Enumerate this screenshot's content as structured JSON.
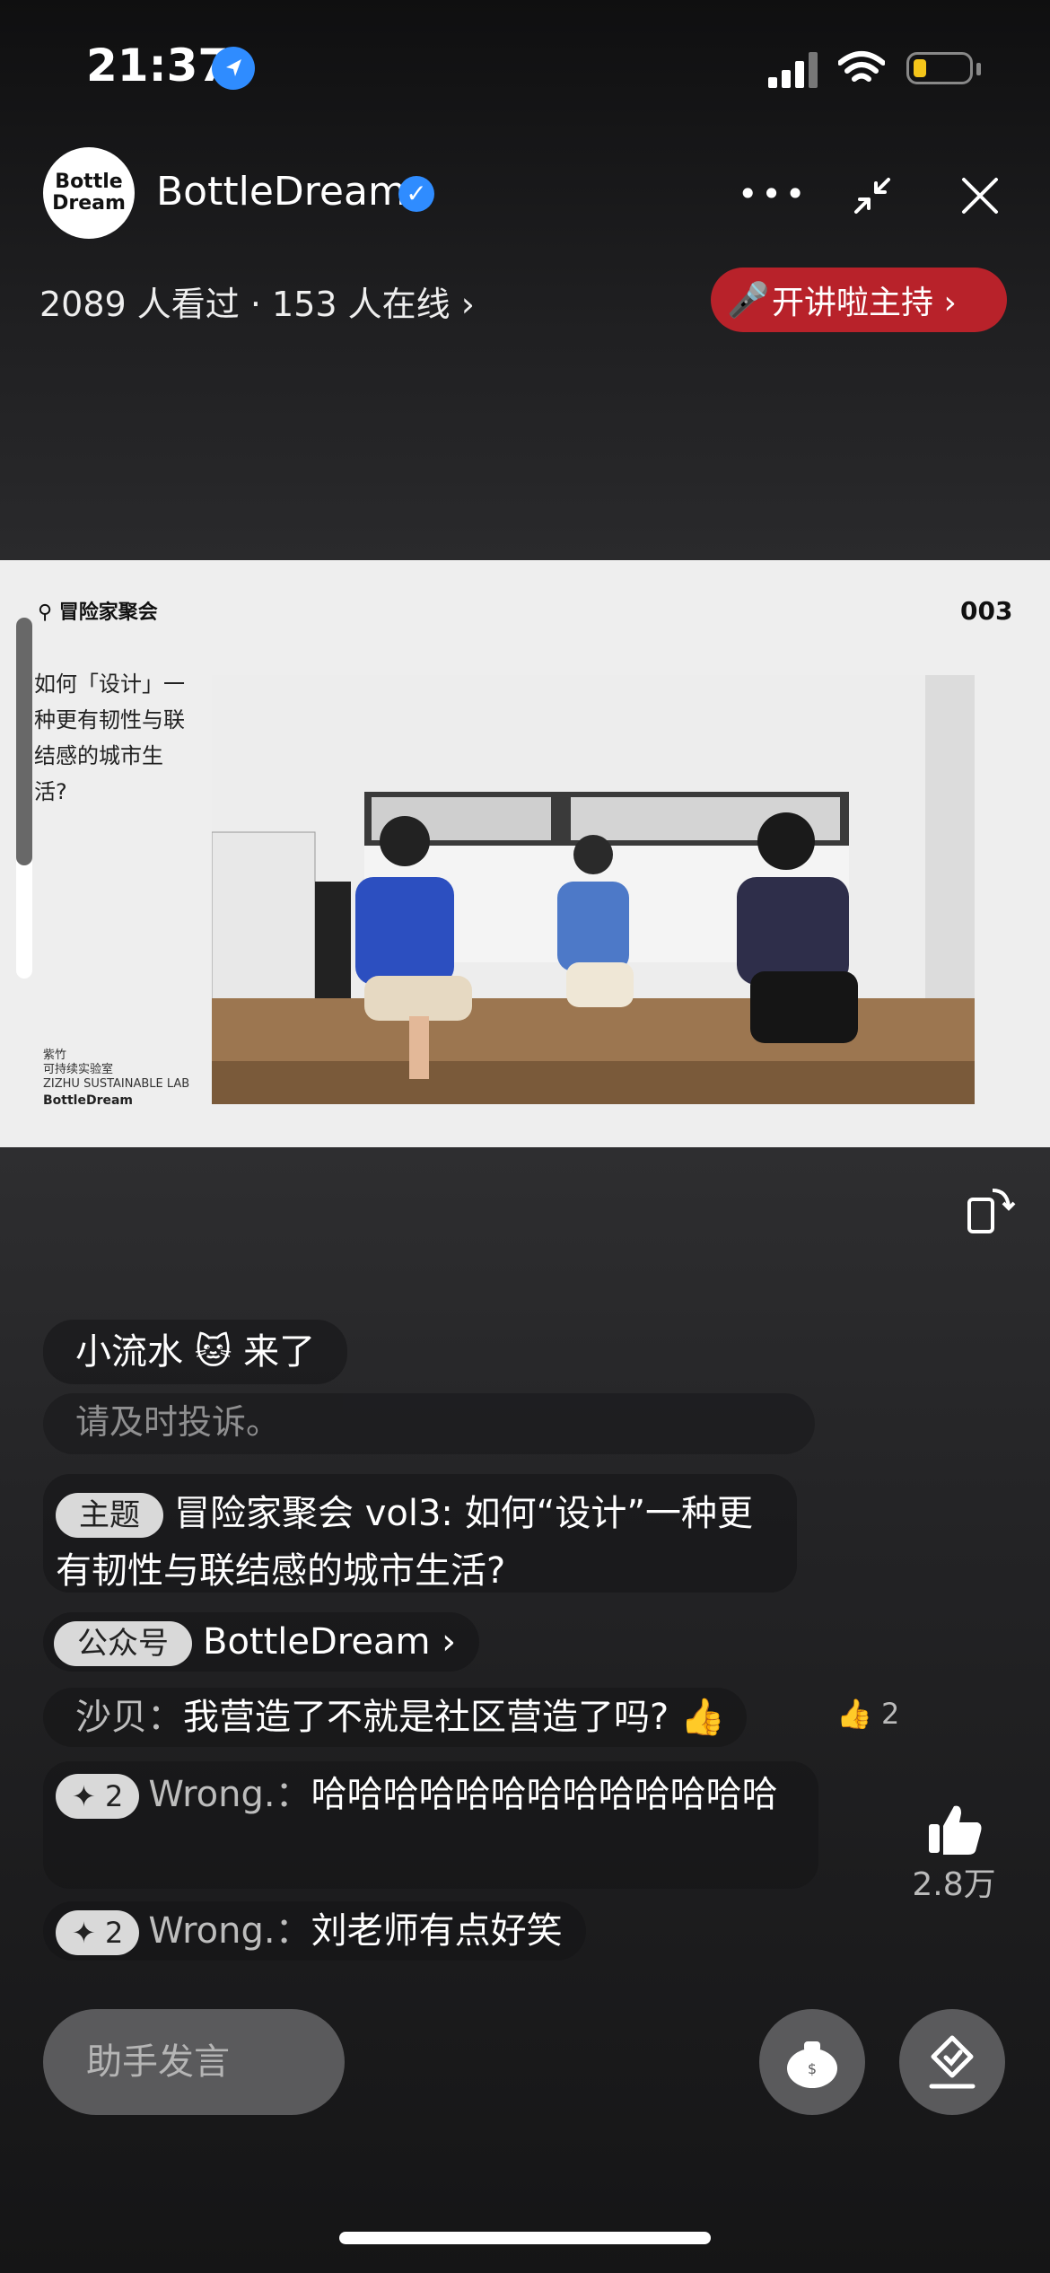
{
  "status": {
    "time": "21:37"
  },
  "header": {
    "avatar_text": "Bottle\nDream",
    "channel_name": "BottleDream",
    "viewers": "2089 人看过 · 153 人在线 ›",
    "host_button": "开讲啦主持 ›"
  },
  "slide": {
    "logo": "冒险家聚会",
    "number": "003",
    "question": "如何「设计」一种更有韧性与联结感的城市生活?",
    "org": "紫竹\n可持续实验室\nZIZHU SUSTAINABLE LAB",
    "brand": "BottleDream"
  },
  "comments": {
    "join": "小流水 🐱 来了",
    "warning": "请及时投诉。",
    "topic_tag": "主题",
    "topic_text": "冒险家聚会 vol3: 如何“设计”一种更有韧性与联结感的城市生活?",
    "gzh_tag": "公众号",
    "gzh_name": "BottleDream ›",
    "c1_user": "沙贝：",
    "c1_text": "我营造了不就是社区营造了吗? 👍",
    "c1_likes": "2",
    "c2_badge": "✦ 2",
    "c2_user": "Wrong.：",
    "c2_text": "哈哈哈哈哈哈哈哈哈哈哈哈哈",
    "c3_badge": "✦ 2",
    "c3_user": "Wrong.：",
    "c3_text": "刘老师有点好笑"
  },
  "like": {
    "count": "2.8万"
  },
  "bottom": {
    "assist_placeholder": "助手发言"
  }
}
